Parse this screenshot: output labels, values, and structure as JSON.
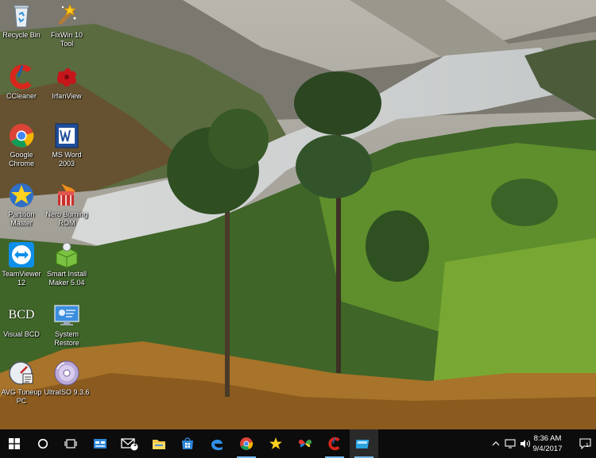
{
  "desktop": {
    "icons": [
      {
        "label": "Recycle Bin",
        "icon": "recycle-bin-icon"
      },
      {
        "label": "FixWin 10\nTool",
        "icon": "fixwin-icon"
      },
      {
        "label": "CCleaner",
        "icon": "ccleaner-icon"
      },
      {
        "label": "IrfanView",
        "icon": "irfanview-icon"
      },
      {
        "label": "Google\nChrome",
        "icon": "chrome-icon"
      },
      {
        "label": "MS Word\n2003",
        "icon": "word-icon"
      },
      {
        "label": "Partition\nMaster",
        "icon": "partition-master-icon"
      },
      {
        "label": "Nero Burning\nROM",
        "icon": "nero-icon"
      },
      {
        "label": "TeamViewer\n12",
        "icon": "teamviewer-icon"
      },
      {
        "label": "Smart Install\nMaker 5.04",
        "icon": "smart-install-maker-icon"
      },
      {
        "label": "Visual BCD",
        "icon": "visual-bcd-icon"
      },
      {
        "label": "System\nRestore",
        "icon": "system-restore-icon"
      },
      {
        "label": "AVG Tuneup\nPC",
        "icon": "avg-tuneup-icon"
      },
      {
        "label": "UltraISO 9.3.6",
        "icon": "ultraiso-icon"
      }
    ],
    "bcd_text": "BCD"
  },
  "taskbar": {
    "mail_badge": "1",
    "clock": {
      "time": "8:36 AM",
      "date": "9/4/2017"
    },
    "notification_count": "1"
  }
}
